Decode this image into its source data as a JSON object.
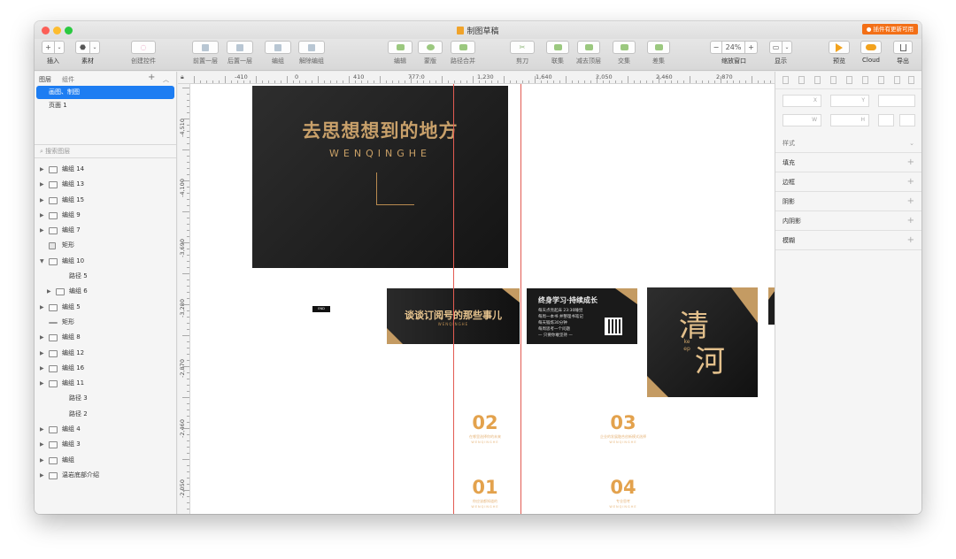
{
  "window": {
    "title": "制图草稿",
    "update_badge": "● 插件有更新可用"
  },
  "toolbar": {
    "insert": "插入",
    "assets": "素材",
    "create_symbol": "创建控件",
    "bring_forward": "前置一层",
    "send_backward": "后置一层",
    "group": "编组",
    "ungroup": "解除编组",
    "edit": "编辑",
    "mask": "蒙版",
    "path_union": "路径合并",
    "scissors": "剪刀",
    "union": "联集",
    "subtract": "减去顶层",
    "intersect": "交集",
    "difference": "差集",
    "zoom_label": "缩放窗口",
    "zoom_value": "24%",
    "display": "显示",
    "preview": "预览",
    "cloud": "Cloud",
    "export": "导出"
  },
  "left_panel": {
    "tab_layers": "图层",
    "tab_components": "组件",
    "pages": [
      "画图、制图",
      "页面 1"
    ],
    "search_placeholder": "搜索图层",
    "layers": [
      {
        "name": "编组 14",
        "type": "group",
        "indent": 0,
        "arrow": "▶"
      },
      {
        "name": "编组 13",
        "type": "group",
        "indent": 0,
        "arrow": "▶"
      },
      {
        "name": "编组 15",
        "type": "group",
        "indent": 0,
        "arrow": "▶"
      },
      {
        "name": "编组 9",
        "type": "group",
        "indent": 0,
        "arrow": "▶"
      },
      {
        "name": "编组 7",
        "type": "group",
        "indent": 0,
        "arrow": "▶"
      },
      {
        "name": "矩形",
        "type": "rect",
        "indent": 0,
        "arrow": ""
      },
      {
        "name": "编组 10",
        "type": "group",
        "indent": 0,
        "arrow": "▼"
      },
      {
        "name": "路径 5",
        "type": "path",
        "indent": 1,
        "arrow": ""
      },
      {
        "name": "编组 6",
        "type": "group",
        "indent": 1,
        "arrow": "▶"
      },
      {
        "name": "编组 5",
        "type": "group",
        "indent": 0,
        "arrow": "▶"
      },
      {
        "name": "矩形",
        "type": "line",
        "indent": 0,
        "arrow": ""
      },
      {
        "name": "编组 8",
        "type": "group",
        "indent": 0,
        "arrow": "▶"
      },
      {
        "name": "编组 12",
        "type": "group",
        "indent": 0,
        "arrow": "▶"
      },
      {
        "name": "编组 16",
        "type": "group",
        "indent": 0,
        "arrow": "▶"
      },
      {
        "name": "编组 11",
        "type": "group",
        "indent": 0,
        "arrow": "▶"
      },
      {
        "name": "路径 3",
        "type": "path",
        "indent": 1,
        "arrow": ""
      },
      {
        "name": "路径 2",
        "type": "path",
        "indent": 1,
        "arrow": ""
      },
      {
        "name": "编组 4",
        "type": "group",
        "indent": 0,
        "arrow": "▶"
      },
      {
        "name": "编组 3",
        "type": "group",
        "indent": 0,
        "arrow": "▶"
      },
      {
        "name": "编组",
        "type": "group",
        "indent": 0,
        "arrow": "▶"
      },
      {
        "name": "温岩底部介绍",
        "type": "group",
        "indent": 0,
        "arrow": "▶"
      }
    ]
  },
  "right_panel": {
    "field_x": "X",
    "field_y": "Y",
    "field_w": "W",
    "field_h": "H",
    "style": "样式",
    "fill": "填充",
    "border": "边框",
    "shadow": "阴影",
    "inner_shadow": "内阴影",
    "blur": "模糊"
  },
  "ruler": {
    "top_labels": [
      "-410",
      "0",
      "410",
      "777:0",
      "1,230",
      "1,640",
      "2,050",
      "2,460",
      "2,870"
    ],
    "left_labels": [
      "-4,510",
      "-4,100",
      "-3,690",
      "-3,280",
      "-2,870",
      "-2,460",
      "-2,050"
    ]
  },
  "canvas": {
    "main_title": "去思想想到的地方",
    "main_sub": "WENQINGHE",
    "end_tag": "END",
    "card_b_title": "谈谈订阅号的那些事儿",
    "card_b_sub": "WENQINGHE",
    "card_c_title": "终身学习·持续成长",
    "card_c_lines": [
      "每天点亮起床 23:30睡觉",
      "每周一本书 并整理书笔记",
      "每天锻炼30分钟",
      "每周思考一个问题",
      "— 只要你敢坚持 —"
    ],
    "card_d_char1": "清",
    "card_d_char2": "河",
    "card_d_keep": "keep",
    "numbers": [
      {
        "n": "02",
        "s1": "在哪里选择你的未来",
        "s2": "WENQINGHE"
      },
      {
        "n": "03",
        "s1": "企业的发展融合创新模式选择",
        "s2": "WENQINGHE"
      },
      {
        "n": "01",
        "s1": "你应该都知道的",
        "s2": "WENQINGHE"
      },
      {
        "n": "04",
        "s1": "专业思考",
        "s2": "WENQINGHE"
      }
    ]
  },
  "colors": {
    "accent": "#1d7df2",
    "gold": "#c9a066",
    "orange_number": "#e3a24d",
    "guide": "#e25b52"
  }
}
